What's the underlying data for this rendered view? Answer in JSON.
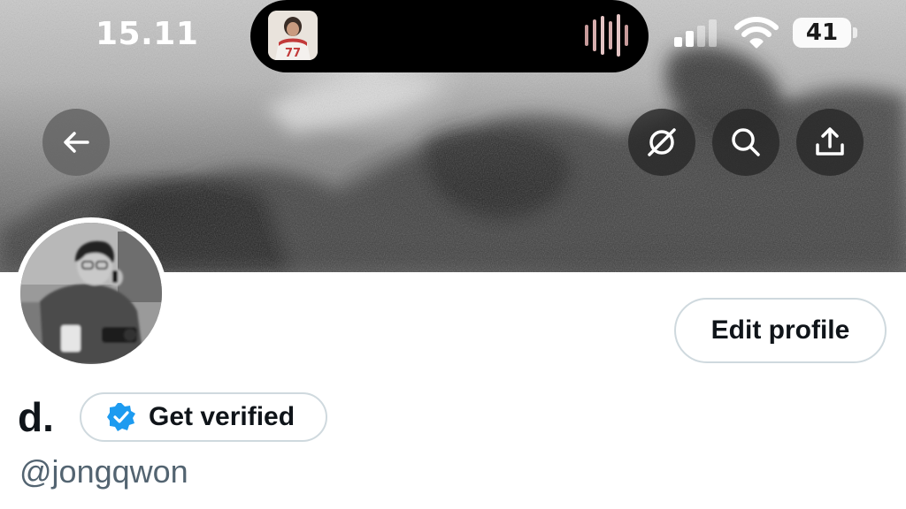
{
  "status_bar": {
    "time": "15.11",
    "battery_level": "41",
    "signal_bars_active": 2,
    "signal_bars_total": 4,
    "now_playing_artwork_text": "77"
  },
  "header_actions": {
    "back_icon": "arrow-left-icon",
    "grok_icon": "grok-icon",
    "search_icon": "search-icon",
    "share_icon": "share-icon"
  },
  "profile": {
    "edit_button_label": "Edit profile",
    "display_name": "d.",
    "get_verified_label": "Get verified",
    "handle": "@jongqwon",
    "verified_badge_color": "#1d9bf0"
  },
  "colors": {
    "text_primary": "#0f1419",
    "text_secondary": "#536471",
    "border": "#cfd9de"
  }
}
